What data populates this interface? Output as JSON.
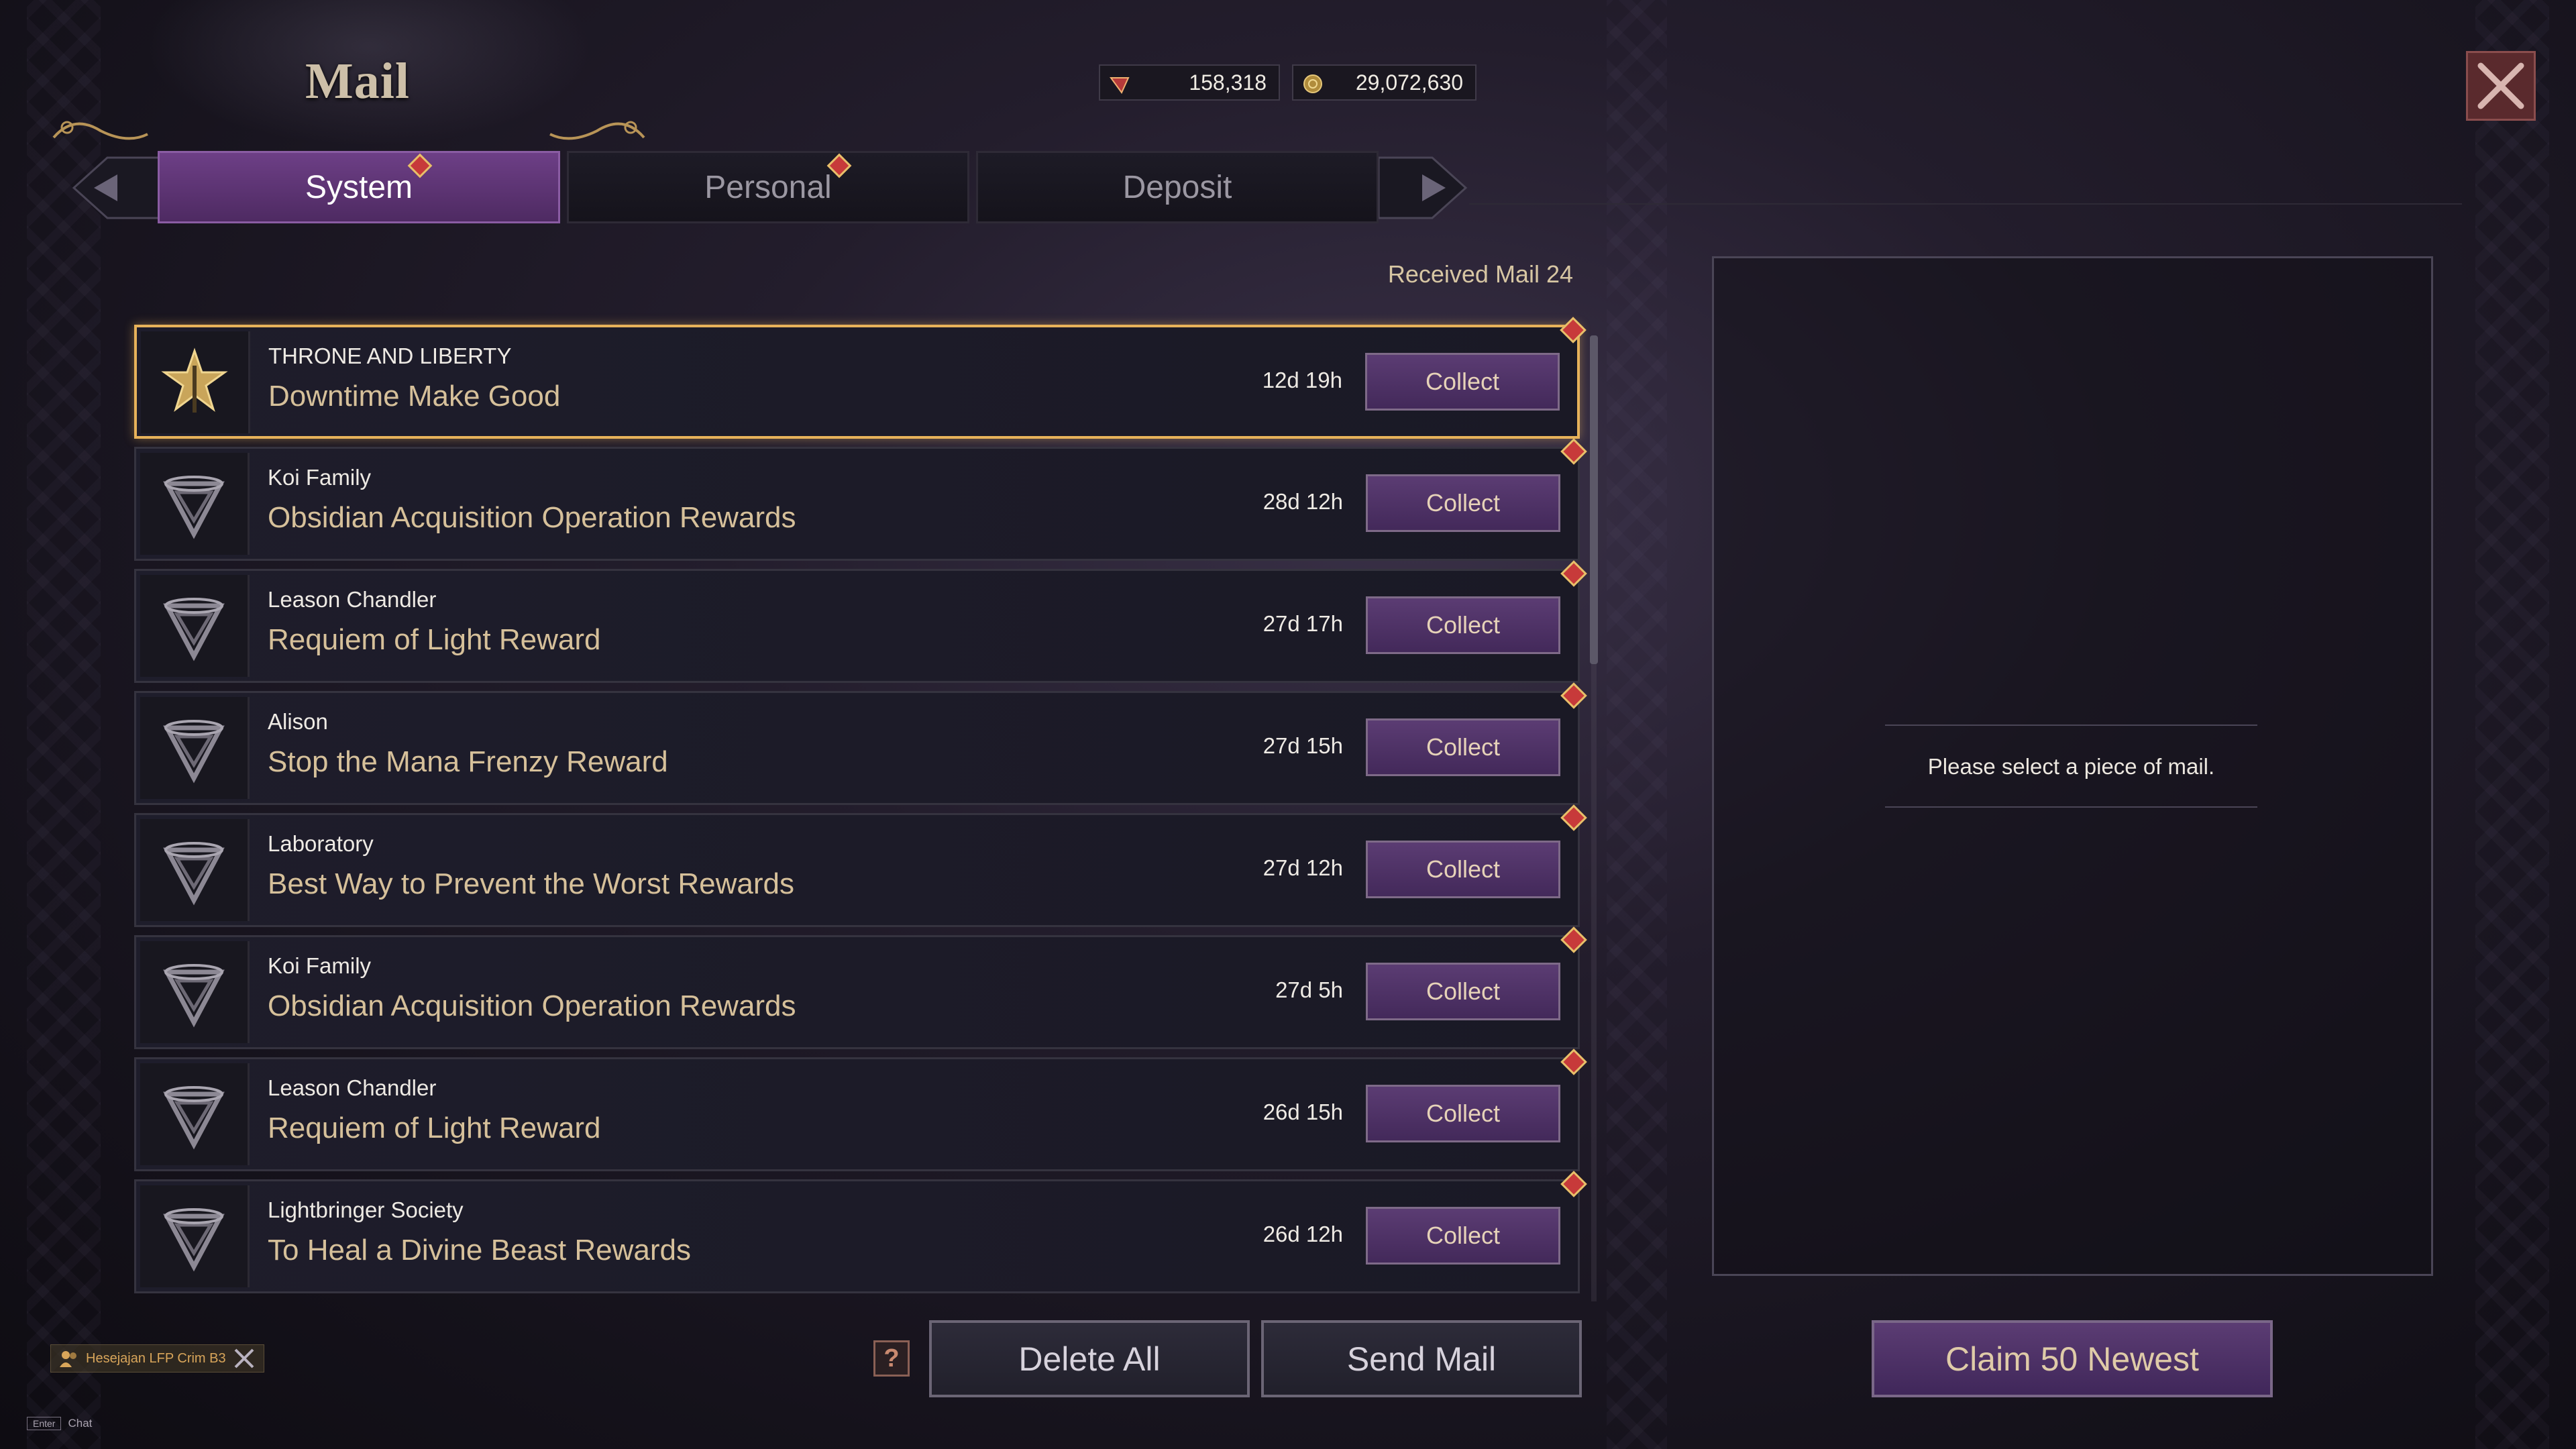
{
  "window": {
    "title": "Mail"
  },
  "currency": [
    {
      "icon": "red-gem-icon",
      "value": "158,318"
    },
    {
      "icon": "gold-coin-icon",
      "value": "29,072,630"
    }
  ],
  "tabs": [
    {
      "label": "System",
      "active": true,
      "has_alert": true
    },
    {
      "label": "Personal",
      "active": false,
      "has_alert": true
    },
    {
      "label": "Deposit",
      "active": false,
      "has_alert": false
    }
  ],
  "received": {
    "label": "Received Mail 24"
  },
  "mails": [
    {
      "sender": "THRONE AND LIBERTY",
      "subject": "Downtime Make Good",
      "time": "12d 19h",
      "action": "Collect",
      "icon": "game-emblem-icon",
      "selected": true
    },
    {
      "sender": "Koi Family",
      "subject": "Obsidian Acquisition Operation Rewards",
      "time": "28d 12h",
      "action": "Collect",
      "icon": "faction-shield-icon",
      "selected": false
    },
    {
      "sender": "Leason Chandler",
      "subject": "Requiem of Light Reward",
      "time": "27d 17h",
      "action": "Collect",
      "icon": "faction-shield-icon",
      "selected": false
    },
    {
      "sender": "Alison",
      "subject": "Stop the Mana Frenzy Reward",
      "time": "27d 15h",
      "action": "Collect",
      "icon": "faction-shield-icon",
      "selected": false
    },
    {
      "sender": "Laboratory",
      "subject": "Best Way to Prevent the Worst Rewards",
      "time": "27d 12h",
      "action": "Collect",
      "icon": "faction-shield-icon",
      "selected": false
    },
    {
      "sender": "Koi Family",
      "subject": "Obsidian Acquisition Operation Rewards",
      "time": "27d 5h",
      "action": "Collect",
      "icon": "faction-shield-icon",
      "selected": false
    },
    {
      "sender": "Leason Chandler",
      "subject": "Requiem of Light Reward",
      "time": "26d 15h",
      "action": "Collect",
      "icon": "faction-shield-icon",
      "selected": false
    },
    {
      "sender": "Lightbringer Society",
      "subject": "To Heal a Divine Beast Rewards",
      "time": "26d 12h",
      "action": "Collect",
      "icon": "faction-shield-icon",
      "selected": false
    }
  ],
  "preview": {
    "empty_text": "Please select a piece of mail."
  },
  "buttons": {
    "help": "?",
    "delete_all": "Delete All",
    "send_mail": "Send Mail",
    "claim": "Claim 50 Newest"
  },
  "chat": {
    "party_tag": "Hesejajan  LFP Crim B3",
    "enter_key": "Enter",
    "chat_label": "Chat"
  },
  "colors": {
    "accent_purple": "#5b3c73",
    "selected_border": "#e7b25a",
    "subject_gold": "#d6c09a",
    "alert_red": "#c73a3a"
  }
}
